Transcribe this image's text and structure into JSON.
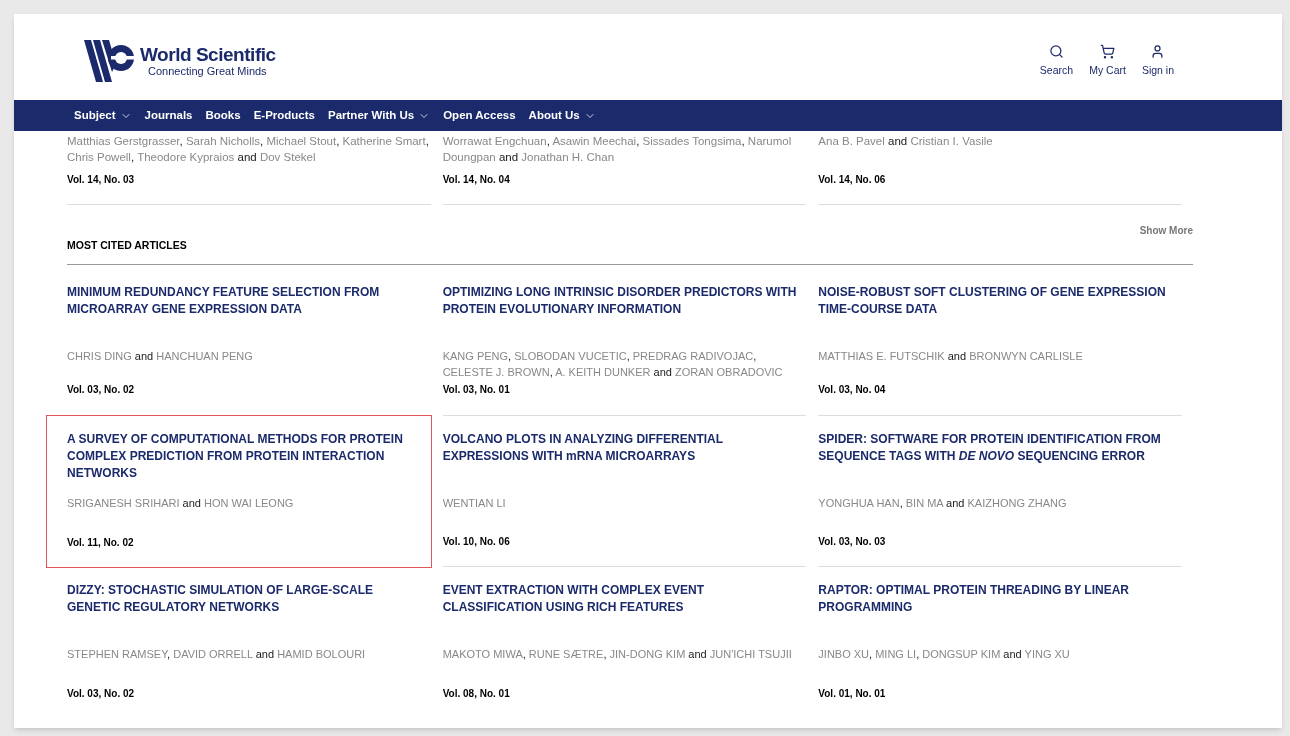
{
  "header": {
    "brand": "World Scientific",
    "tagline": "Connecting Great Minds",
    "actions": [
      {
        "kind": "search",
        "label": "Search"
      },
      {
        "kind": "cart",
        "label": "My Cart"
      },
      {
        "kind": "user",
        "label": "Sign in"
      }
    ]
  },
  "nav": [
    {
      "label": "Subject",
      "dropdown": true
    },
    {
      "label": "Journals",
      "dropdown": false
    },
    {
      "label": "Books",
      "dropdown": false
    },
    {
      "label": "E-Products",
      "dropdown": false
    },
    {
      "label": "Partner With Us",
      "dropdown": true
    },
    {
      "label": "Open Access",
      "dropdown": false
    },
    {
      "label": "About Us",
      "dropdown": true
    }
  ],
  "previous_articles": [
    {
      "authors": [
        {
          "name": "Matthias Gerstgrasser",
          "sep": ","
        },
        {
          "name": "Sarah Nicholls",
          "sep": ","
        },
        {
          "name": "Michael Stout",
          "sep": ","
        },
        {
          "name": "Katherine Smart",
          "sep": ","
        },
        {
          "name": "Chris Powell",
          "sep": ","
        },
        {
          "name": "Theodore Kypraios",
          "sep": " and"
        },
        {
          "name": "Dov Stekel"
        }
      ],
      "volume": "Vol. 14, No. 03"
    },
    {
      "authors": [
        {
          "name": "Worrawat Engchuan",
          "sep": ","
        },
        {
          "name": "Asawin Meechai",
          "sep": ","
        },
        {
          "name": "Sissades Tongsima",
          "sep": ","
        },
        {
          "name": "Narumol Doungpan",
          "sep": " and"
        },
        {
          "name": "Jonathan H. Chan"
        }
      ],
      "volume": "Vol. 14, No. 04"
    },
    {
      "authors": [
        {
          "name": "Ana B. Pavel",
          "sep": " and"
        },
        {
          "name": "Cristian I. Vasile"
        }
      ],
      "volume": "Vol. 14, No. 06"
    }
  ],
  "show_more": "Show More",
  "most_cited": {
    "heading": "MOST CITED ARTICLES",
    "articles": [
      {
        "title": "MINIMUM REDUNDANCY FEATURE SELECTION FROM MICROARRAY GENE EXPRESSION DATA",
        "authors": [
          {
            "name": "CHRIS DING",
            "sep": " and"
          },
          {
            "name": "HANCHUAN PENG"
          }
        ],
        "volume": "Vol. 03, No. 02",
        "selected": false
      },
      {
        "title": "OPTIMIZING LONG INTRINSIC DISORDER PREDICTORS WITH PROTEIN EVOLUTIONARY INFORMATION",
        "authors": [
          {
            "name": "KANG PENG",
            "sep": ","
          },
          {
            "name": "SLOBODAN VUCETIC",
            "sep": ","
          },
          {
            "name": "PREDRAG RADIVOJAC",
            "sep": ","
          },
          {
            "name": "CELESTE J. BROWN",
            "sep": ","
          },
          {
            "name": "A. KEITH DUNKER",
            "sep": " and"
          },
          {
            "name": "ZORAN OBRADOVIC"
          }
        ],
        "volume": "Vol. 03, No. 01",
        "selected": false
      },
      {
        "title": "NOISE-ROBUST SOFT CLUSTERING OF GENE EXPRESSION TIME-COURSE DATA",
        "authors": [
          {
            "name": "MATTHIAS E. FUTSCHIK",
            "sep": " and"
          },
          {
            "name": "BRONWYN CARLISLE"
          }
        ],
        "volume": "Vol. 03, No. 04",
        "selected": false
      },
      {
        "title": "A SURVEY OF COMPUTATIONAL METHODS FOR PROTEIN COMPLEX PREDICTION FROM PROTEIN INTERACTION NETWORKS",
        "authors": [
          {
            "name": "SRIGANESH SRIHARI",
            "sep": " and"
          },
          {
            "name": "HON WAI LEONG"
          }
        ],
        "volume": "Vol. 11, No. 02",
        "selected": true
      },
      {
        "title": "VOLCANO PLOTS IN ANALYZING DIFFERENTIAL EXPRESSIONS WITH mRNA MICROARRAYS",
        "authors": [
          {
            "name": "WENTIAN LI"
          }
        ],
        "volume": "Vol. 10, No. 06",
        "selected": false
      },
      {
        "title": "SPIDER: SOFTWARE FOR PROTEIN IDENTIFICATION FROM SEQUENCE TAGS WITH *DE NOVO* SEQUENCING ERROR",
        "authors": [
          {
            "name": "YONGHUA HAN",
            "sep": ","
          },
          {
            "name": "BIN MA",
            "sep": " and"
          },
          {
            "name": "KAIZHONG ZHANG"
          }
        ],
        "volume": "Vol. 03, No. 03",
        "selected": false
      },
      {
        "title": "DIZZY: STOCHASTIC SIMULATION OF LARGE-SCALE GENETIC REGULATORY NETWORKS",
        "authors": [
          {
            "name": "STEPHEN RAMSEY",
            "sep": ","
          },
          {
            "name": "DAVID ORRELL",
            "sep": " and"
          },
          {
            "name": "HAMID BOLOURI"
          }
        ],
        "volume": "Vol. 03, No. 02",
        "selected": false
      },
      {
        "title": "EVENT EXTRACTION WITH COMPLEX EVENT CLASSIFICATION USING RICH FEATURES",
        "authors": [
          {
            "name": "MAKOTO MIWA",
            "sep": ","
          },
          {
            "name": "RUNE SÆTRE",
            "sep": ","
          },
          {
            "name": "JIN-DONG KIM",
            "sep": " and"
          },
          {
            "name": "JUN'ICHI TSUJII"
          }
        ],
        "volume": "Vol. 08, No. 01",
        "selected": false
      },
      {
        "title": "RAPTOR: OPTIMAL PROTEIN THREADING BY LINEAR PROGRAMMING",
        "authors": [
          {
            "name": "JINBO XU",
            "sep": ","
          },
          {
            "name": "MING LI",
            "sep": ","
          },
          {
            "name": "DONGSUP KIM",
            "sep": " and"
          },
          {
            "name": "YING XU"
          }
        ],
        "volume": "Vol. 01, No. 01",
        "selected": false
      }
    ]
  }
}
